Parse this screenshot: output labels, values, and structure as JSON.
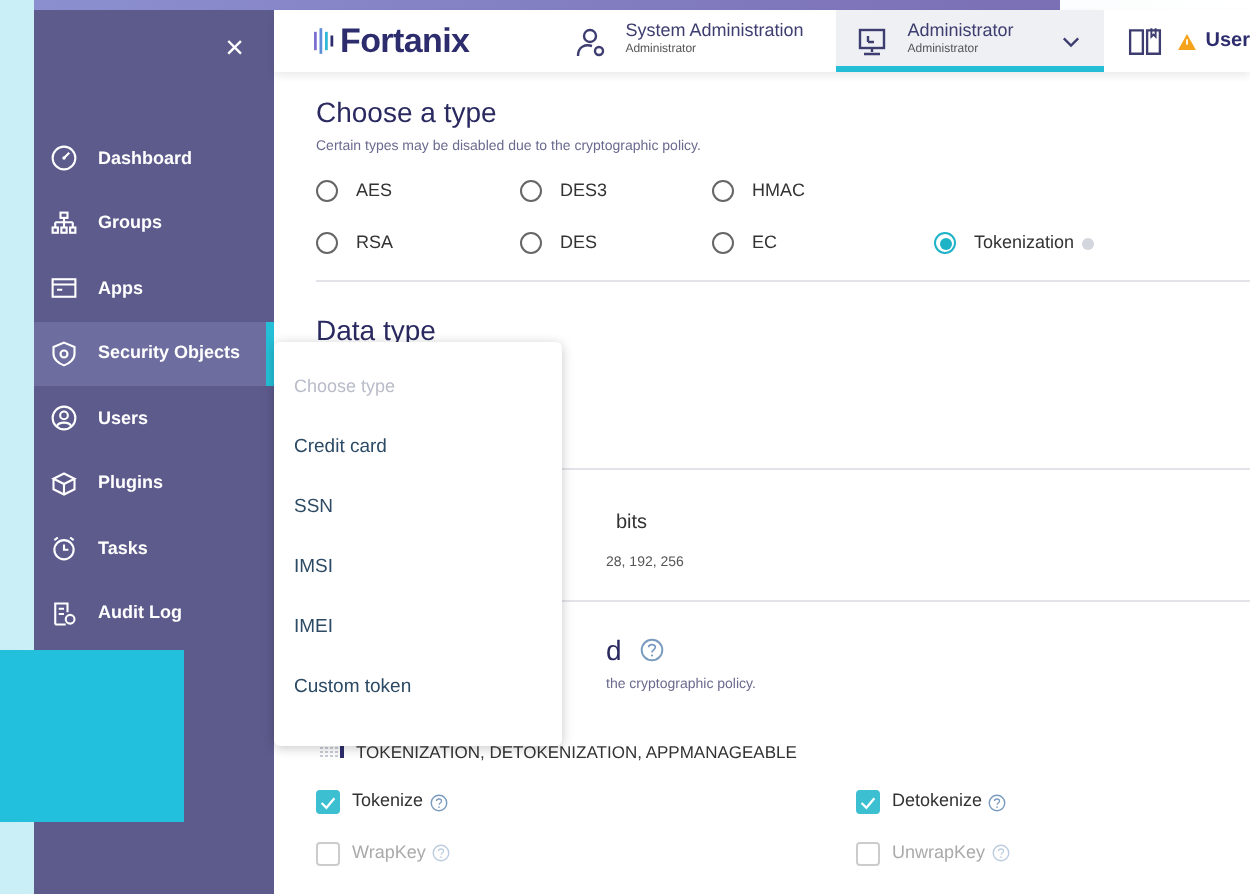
{
  "sidebar": {
    "close": "×",
    "items": [
      {
        "label": "Dashboard",
        "selected": false
      },
      {
        "label": "Groups",
        "selected": false
      },
      {
        "label": "Apps",
        "selected": false
      },
      {
        "label": "Security Objects",
        "selected": true
      },
      {
        "label": "Users",
        "selected": false
      },
      {
        "label": "Plugins",
        "selected": false
      },
      {
        "label": "Tasks",
        "selected": false
      },
      {
        "label": "Audit Log",
        "selected": false
      }
    ]
  },
  "header": {
    "logo": "Fortanix",
    "nav": [
      {
        "title": "System Administration",
        "subtitle": "Administrator",
        "selected": false
      },
      {
        "title": "Administrator",
        "subtitle": "Administrator",
        "selected": true
      }
    ],
    "user": "User"
  },
  "type_section": {
    "title": "Choose a type",
    "note": "Certain types may be disabled due to the cryptographic policy.",
    "options": [
      {
        "label": "AES",
        "selected": false
      },
      {
        "label": "DES3",
        "selected": false
      },
      {
        "label": "HMAC",
        "selected": false
      },
      {
        "label": "RSA",
        "selected": false
      },
      {
        "label": "DES",
        "selected": false
      },
      {
        "label": "EC",
        "selected": false
      },
      {
        "label": "Tokenization",
        "selected": true,
        "info": true
      }
    ]
  },
  "data_type": {
    "title": "Data type",
    "dropdown": {
      "hint_option": "Choose type",
      "options": [
        "Credit card",
        "SSN",
        "IMSI",
        "IMEI",
        "Custom token"
      ]
    }
  },
  "size_section": {
    "unit": "bits",
    "hint": "28, 192, 256"
  },
  "ops_section": {
    "title": "d",
    "note": "the cryptographic policy.",
    "permissions": "TOKENIZATION, DETOKENIZATION, APPMANAGEABLE",
    "checkboxes": [
      {
        "label": "Tokenize",
        "checked": true,
        "disabled": false
      },
      {
        "label": "Detokenize",
        "checked": true,
        "disabled": false
      },
      {
        "label": "WrapKey",
        "checked": false,
        "disabled": true
      },
      {
        "label": "UnwrapKey",
        "checked": false,
        "disabled": true
      }
    ]
  }
}
